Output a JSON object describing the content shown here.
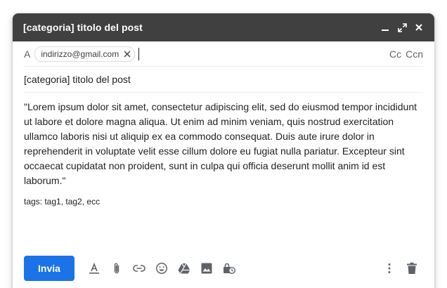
{
  "window": {
    "title": "[categoria] titolo del post",
    "minimize_icon": "minimize-icon",
    "expand_icon": "expand-icon",
    "close_icon": "close-icon"
  },
  "recipients": {
    "label": "A",
    "chip": "indirizzo@gmail.com",
    "cc": "Cc",
    "bcc": "Ccn"
  },
  "subject": "[categoria] titolo del post",
  "message": {
    "body": "\"Lorem ipsum dolor sit amet, consectetur adipiscing elit, sed do eiusmod tempor incididunt ut labore et dolore magna aliqua. Ut enim ad minim veniam, quis nostrud exercitation ullamco laboris nisi ut aliquip ex ea commodo consequat. Duis aute irure dolor in reprehenderit in voluptate velit esse cillum dolore eu fugiat nulla pariatur. Excepteur sint occaecat cupidatat non proident, sunt in culpa qui officia deserunt mollit anim id est laborum.\"",
    "tags": "tags: tag1, tag2, ecc"
  },
  "toolbar": {
    "send_label": "Invia",
    "accent": "#1a73e8",
    "icons": [
      "format-text-icon",
      "attach-icon",
      "link-icon",
      "emoji-icon",
      "drive-icon",
      "image-icon",
      "confidential-icon",
      "more-options-icon",
      "delete-icon"
    ]
  }
}
